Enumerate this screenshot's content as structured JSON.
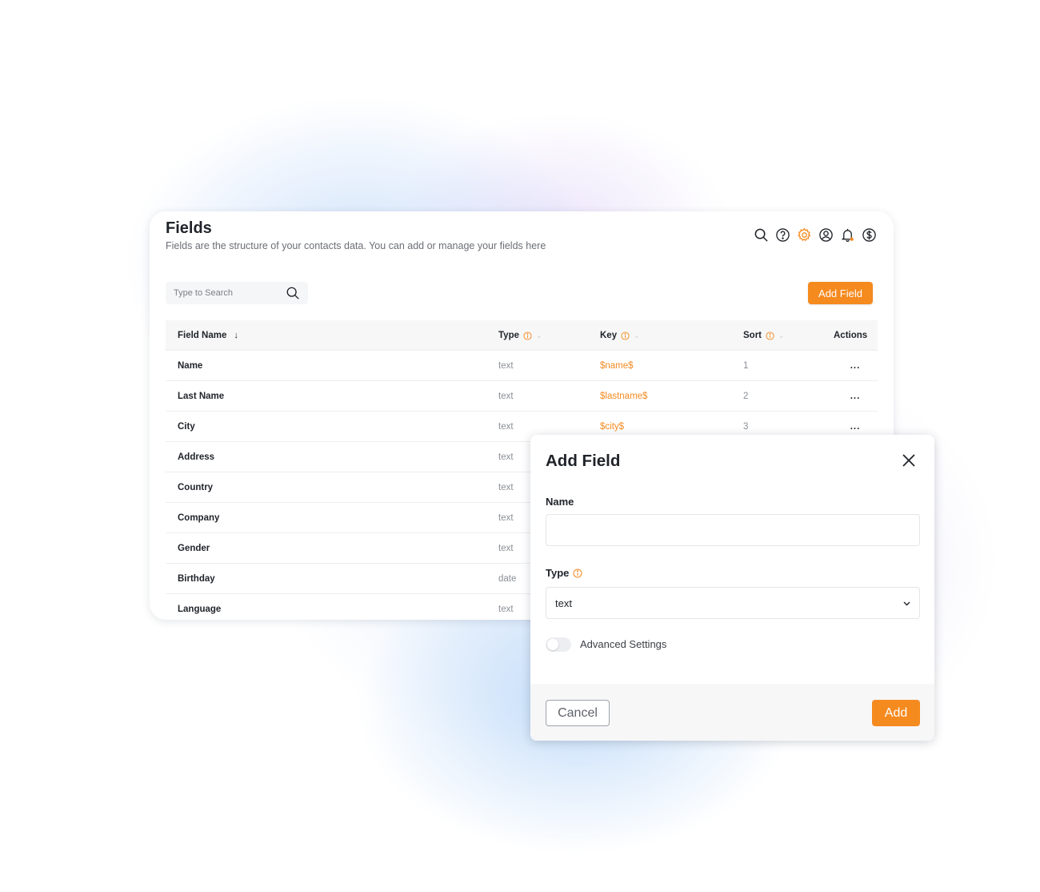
{
  "header": {
    "title": "Fields",
    "subtitle": "Fields are the structure of your contacts data. You can add or manage your fields here",
    "icons": [
      "search-icon",
      "help-icon",
      "settings-icon",
      "user-icon",
      "bell-icon",
      "dollar-icon"
    ]
  },
  "search": {
    "placeholder": "Type to Search"
  },
  "toolbar": {
    "add_field_label": "Add Field"
  },
  "colors": {
    "accent": "#f58a1f",
    "muted": "#8b8f96",
    "text": "#1f2329"
  },
  "table": {
    "columns": {
      "name": "Field Name",
      "type": "Type",
      "key": "Key",
      "sort": "Sort",
      "actions": "Actions"
    },
    "rows": [
      {
        "name": "Name",
        "type": "text",
        "key": "$name$",
        "sort": "1",
        "actions": "..."
      },
      {
        "name": "Last Name",
        "type": "text",
        "key": "$lastname$",
        "sort": "2",
        "actions": "..."
      },
      {
        "name": "City",
        "type": "text",
        "key": "$city$",
        "sort": "3",
        "actions": "..."
      },
      {
        "name": "Address",
        "type": "text",
        "key": "",
        "sort": "",
        "actions": ""
      },
      {
        "name": "Country",
        "type": "text",
        "key": "",
        "sort": "",
        "actions": ""
      },
      {
        "name": "Company",
        "type": "text",
        "key": "",
        "sort": "",
        "actions": ""
      },
      {
        "name": "Gender",
        "type": "text",
        "key": "",
        "sort": "",
        "actions": ""
      },
      {
        "name": "Birthday",
        "type": "date",
        "key": "",
        "sort": "",
        "actions": ""
      },
      {
        "name": "Language",
        "type": "text",
        "key": "",
        "sort": "",
        "actions": ""
      }
    ]
  },
  "modal": {
    "title": "Add Field",
    "name_label": "Name",
    "name_value": "",
    "type_label": "Type",
    "type_value": "text",
    "advanced_label": "Advanced Settings",
    "advanced_enabled": false,
    "cancel_label": "Cancel",
    "add_label": "Add"
  }
}
